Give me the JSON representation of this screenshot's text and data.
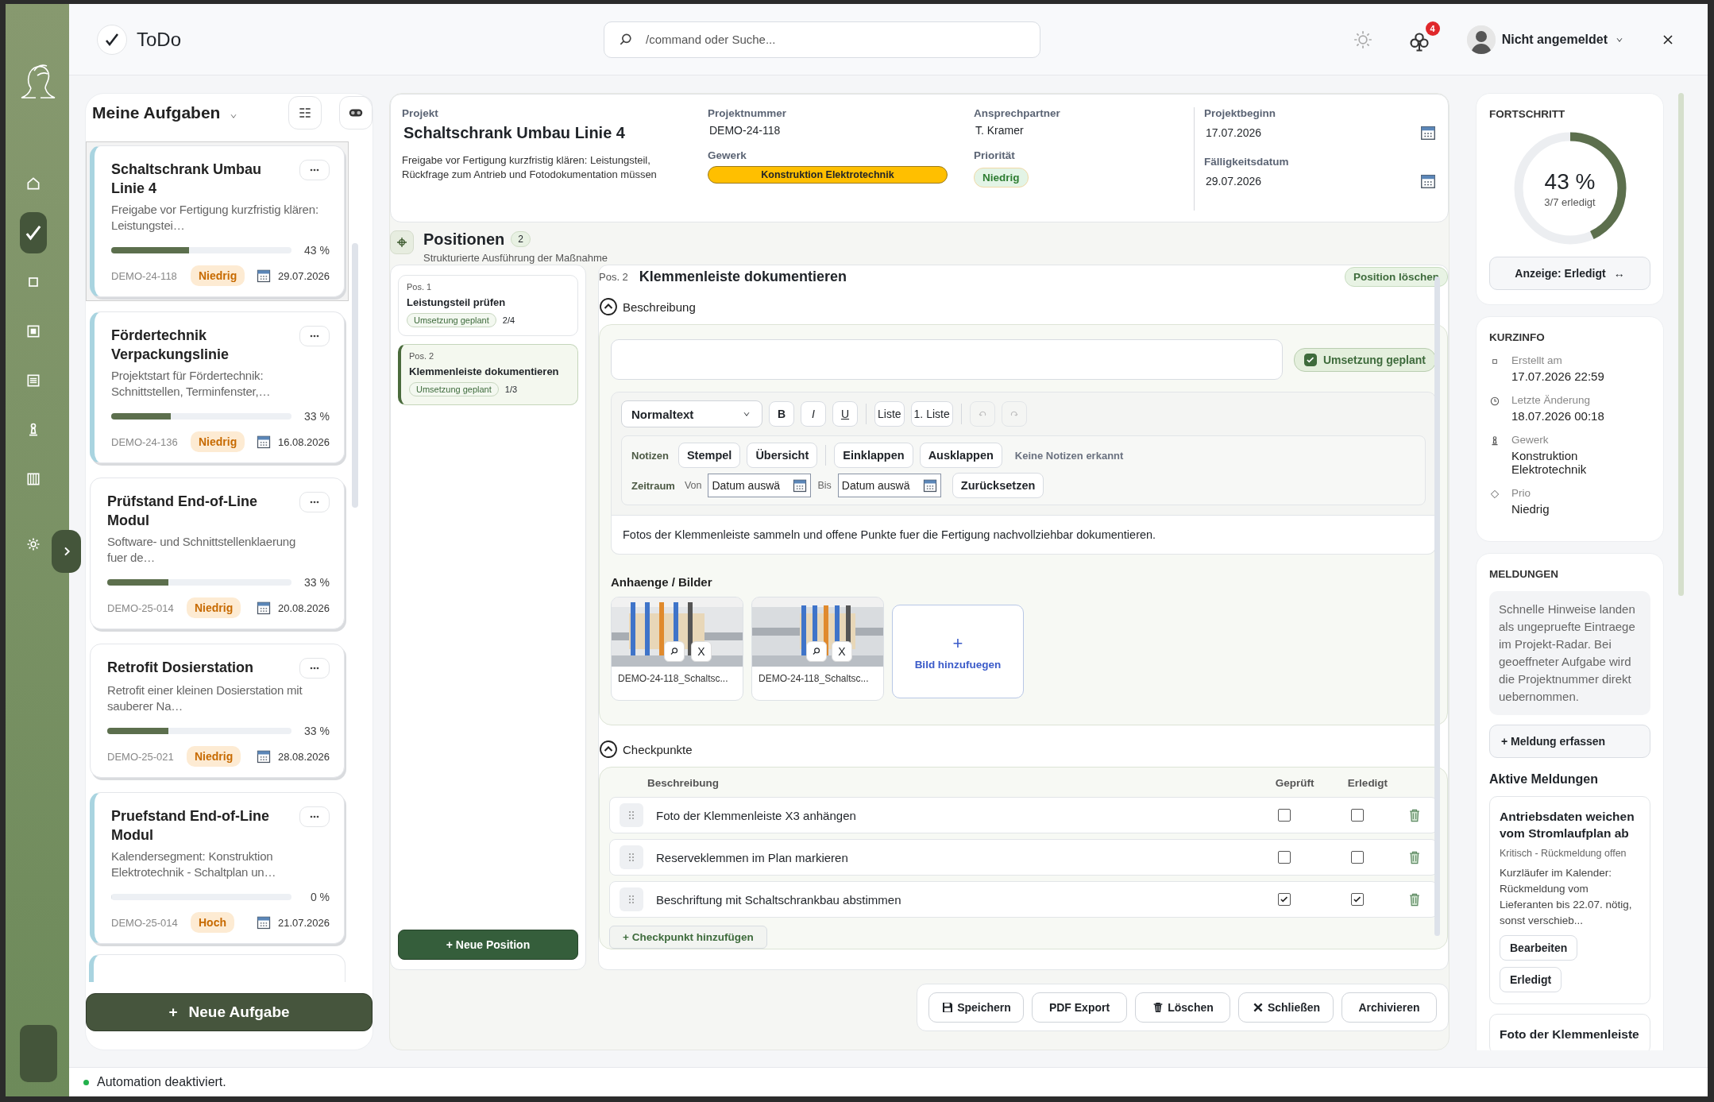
{
  "app": {
    "title": "ToDo"
  },
  "search": {
    "placeholder": "/command oder Suche..."
  },
  "notifications": {
    "count": "4"
  },
  "user": {
    "name": "Nicht angemeldet"
  },
  "nav": [
    {
      "selected": false
    },
    {
      "selected": true
    },
    {
      "selected": false
    },
    {
      "selected": false
    },
    {
      "selected": false
    },
    {
      "selected": false
    },
    {
      "selected": false
    },
    {
      "selected": false
    }
  ],
  "tasks": {
    "title": "Meine Aufgaben",
    "items": [
      {
        "title": "Schaltschrank Umbau Linie 4",
        "description": "Freigabe vor Fertigung kurzfristig klären: Leistungstei…",
        "level": 0.43,
        "percent": "43 %",
        "code": "DEMO-24-118",
        "priority": "Niedrig",
        "date": "29.07.2026",
        "selected": true,
        "accent": true
      },
      {
        "title": "Fördertechnik Verpackungslinie",
        "description": "Projektstart für Fördertechnik: Schnittstellen, Terminfenster,…",
        "level": 0.33,
        "percent": "33 %",
        "code": "DEMO-24-136",
        "priority": "Niedrig",
        "date": "16.08.2026",
        "selected": false,
        "accent": true
      },
      {
        "title": "Prüfstand End-of-Line Modul",
        "description": "Software- und Schnittstellenklaerung fuer de…",
        "level": 0.33,
        "percent": "33 %",
        "code": "DEMO-25-014",
        "priority": "Niedrig",
        "date": "20.08.2026",
        "selected": false,
        "accent": false
      },
      {
        "title": "Retrofit Dosierstation",
        "description": "Retrofit einer kleinen Dosierstation mit sauberer Na…",
        "level": 0.33,
        "percent": "33 %",
        "code": "DEMO-25-021",
        "priority": "Niedrig",
        "date": "28.08.2026",
        "selected": false,
        "accent": false
      },
      {
        "title": "Pruefstand End-of-Line Modul",
        "description": "Kalendersegment: Konstruktion Elektrotechnik - Schaltplan un…",
        "level": 0,
        "percent": "0 %",
        "code": "DEMO-25-014",
        "priority": "Hoch",
        "date": "21.07.2026",
        "selected": false,
        "accent": true
      }
    ],
    "add_button": "Neue Aufgabe",
    "add_symbol": "+"
  },
  "project": {
    "title_label": "Projekt",
    "title": "Schaltschrank Umbau Linie 4",
    "description": "Freigabe vor Fertigung kurzfristig klären: Leistungsteil, Rückfrage zum Antrieb und Fotodokumentation müssen",
    "number_label": "Projektnummer",
    "number": "DEMO-24-118",
    "trade_label": "Gewerk",
    "trade": "Konstruktion Elektrotechnik",
    "contact_label": "Ansprechpartner",
    "contact": "T. Kramer",
    "priority_label": "Priorität",
    "priority": "Niedrig",
    "start_label": "Projektbeginn",
    "start": "17.07.2026",
    "due_label": "Fälligkeitsdatum",
    "due": "29.07.2026"
  },
  "positions": {
    "title": "Positionen",
    "count": "2",
    "subtitle": "Strukturierte Ausführung der Maßnahme",
    "items": [
      {
        "pos": "Pos. 1",
        "title": "Leistungsteil prüfen",
        "status": "Umsetzung geplant",
        "progress": "2/4",
        "selected": false
      },
      {
        "pos": "Pos. 2",
        "title": "Klemmenleiste dokumentieren",
        "status": "Umsetzung geplant",
        "progress": "1/3",
        "selected": true
      }
    ],
    "add_button": "+ Neue Position"
  },
  "detail": {
    "pos": "Pos. 2",
    "title": "Klemmenleiste dokumentieren",
    "delete_button": "Position löschen",
    "description_section": {
      "label": "Beschreibung",
      "expanded": true
    },
    "status_toggle": {
      "label": "Umsetzung geplant",
      "checked": true
    },
    "editor": {
      "style": "Normaltext",
      "format_buttons": [
        "B",
        "I",
        "U",
        "Liste",
        "1. Liste"
      ],
      "notes_label": "Notizen",
      "note_buttons": [
        "Stempel",
        "Übersicht",
        "Einklappen",
        "Ausklappen"
      ],
      "notes_hint": "Keine Notizen erkannt",
      "range_label": "Zeitraum",
      "from_label": "Von",
      "from_placeholder": "Datum auswä",
      "to_label": "Bis",
      "to_placeholder": "Datum auswä",
      "reset_button": "Zurücksetzen",
      "text": "Fotos der Klemmenleiste sammeln und offene Punkte fuer die Fertigung nachvollziehbar dokumentieren."
    },
    "attachments": {
      "label": "Anhaenge / Bilder",
      "items": [
        {
          "name": "DEMO-24-118_Schaltsc...",
          "remove": "X"
        },
        {
          "name": "DEMO-24-118_Schaltsc...",
          "remove": "X"
        }
      ],
      "add_symbol": "+",
      "add_label": "Bild hinzufuegen"
    },
    "checkpoints": {
      "label": "Checkpunkte",
      "expanded": true,
      "columns": [
        "Beschreibung",
        "Geprüft",
        "Erledigt"
      ],
      "rows": [
        {
          "text": "Foto der Klemmenleiste X3 anhängen",
          "checked": false,
          "done": false
        },
        {
          "text": "Reserveklemmen im Plan markieren",
          "checked": false,
          "done": false
        },
        {
          "text": "Beschriftung mit Schaltschrankbau abstimmen",
          "checked": true,
          "done": true
        }
      ],
      "add_button": "+ Checkpunkt hinzufügen"
    }
  },
  "actions": [
    "Speichern",
    "PDF Export",
    "Löschen",
    "Schließen",
    "Archivieren"
  ],
  "progress": {
    "title": "FORTSCHRITT",
    "percent": "43 %",
    "caption": "3/7 erledigt",
    "level": 0.43,
    "toggle": "Anzeige: Erledigt",
    "toggle_symbol": "↔"
  },
  "info": {
    "title": "KURZINFO",
    "items": [
      {
        "label": "Erstellt am",
        "value": "17.07.2026 22:59"
      },
      {
        "label": "Letzte Änderung",
        "value": "18.07.2026 00:18"
      },
      {
        "label": "Gewerk",
        "value": "Konstruktion Elektrotechnik"
      },
      {
        "label": "Prio",
        "value": "Niedrig"
      }
    ]
  },
  "messages": {
    "title": "MELDUNGEN",
    "hint": "Schnelle Hinweise landen als ungepruefte Eintraege im Projekt-Radar. Bei geoeffneter Aufgabe wird die Projektnummer direkt uebernommen.",
    "add_button": "+ Meldung erfassen",
    "active_title": "Aktive Meldungen",
    "items": [
      {
        "title": "Antriebsdaten weichen vom Stromlaufplan ab",
        "meta": "Kritisch - Rückmeldung offen",
        "text": "Kurzläufer im Kalender: Rückmeldung vom Lieferanten bis 22.07. nötig, sonst verschieb...",
        "buttons": [
          "Bearbeiten",
          "Erledigt"
        ]
      },
      {
        "title": "Foto der Klemmenleiste"
      }
    ]
  },
  "status_bar": {
    "text": "Automation deaktiviert."
  }
}
